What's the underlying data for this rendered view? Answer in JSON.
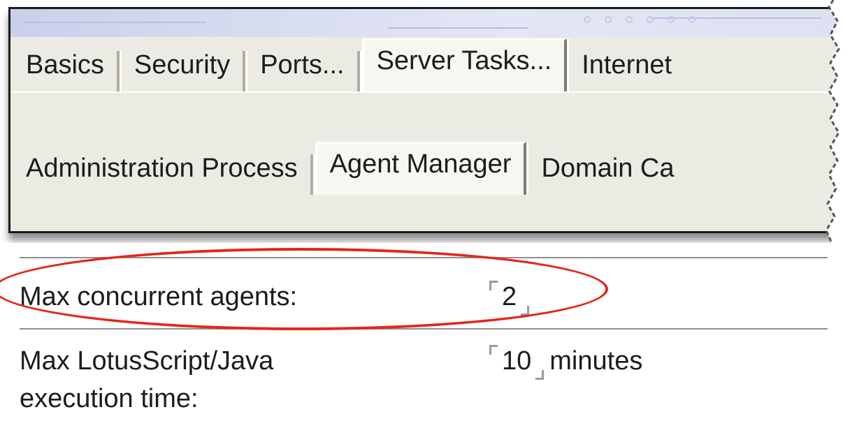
{
  "tabs_primary": [
    {
      "label": "Basics",
      "active": false
    },
    {
      "label": "Security",
      "active": false
    },
    {
      "label": "Ports...",
      "active": false
    },
    {
      "label": "Server Tasks...",
      "active": true
    },
    {
      "label": "Internet",
      "active": false
    }
  ],
  "tabs_secondary": [
    {
      "label": "Administration Process",
      "active": false
    },
    {
      "label": "Agent Manager",
      "active": true
    },
    {
      "label": "Domain Ca",
      "active": false
    }
  ],
  "fields": {
    "max_concurrent_agents": {
      "label": "Max concurrent agents:",
      "value": "2"
    },
    "max_execution_time": {
      "label_line1": "Max LotusScript/Java",
      "label_line2": "execution time:",
      "value": "10",
      "unit": "minutes"
    }
  },
  "colors": {
    "highlight": "#e3261a",
    "dialog_bg": "#ecebe3"
  }
}
